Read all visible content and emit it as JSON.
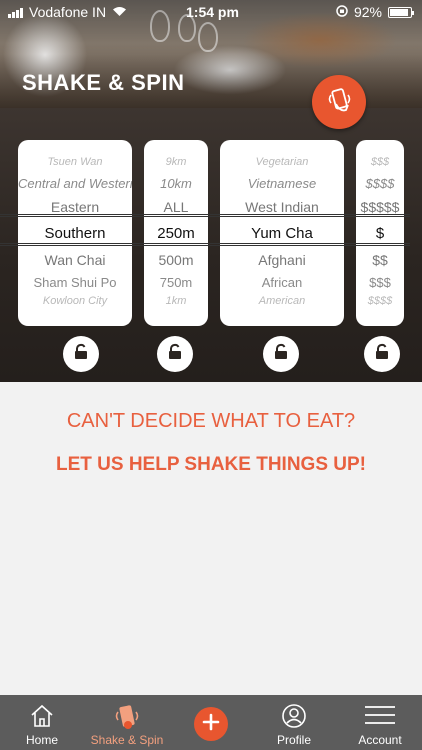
{
  "status_bar": {
    "carrier": "Vodafone IN",
    "time": "1:54 pm",
    "battery": "92%",
    "battery_level": 0.92
  },
  "header": {
    "title": "SHAKE & SPIN",
    "shake_icon": "phone-shake-icon"
  },
  "pickers": [
    {
      "name": "location",
      "items": [
        "Tsuen Wan",
        "Central and Western",
        "Eastern",
        "Southern",
        "Wan Chai",
        "Sham Shui Po",
        "Kowloon City"
      ],
      "selected": "Southern"
    },
    {
      "name": "distance",
      "items": [
        "9km",
        "10km",
        "ALL",
        "250m",
        "500m",
        "750m",
        "1km"
      ],
      "selected": "250m"
    },
    {
      "name": "cuisine",
      "items": [
        "Vegetarian",
        "Vietnamese",
        "West Indian",
        "Yum Cha",
        "Afghani",
        "African",
        "American"
      ],
      "selected": "Yum Cha"
    },
    {
      "name": "price",
      "items": [
        "$$$",
        "$$$$",
        "$$$$$",
        "$",
        "$$",
        "$$$",
        "$$$$"
      ],
      "selected": "$"
    }
  ],
  "locks": [
    "unlock-icon",
    "unlock-icon",
    "unlock-icon",
    "unlock-icon"
  ],
  "messages": {
    "line1": "CAN'T DECIDE WHAT TO EAT?",
    "line2": "LET US HELP SHAKE THINGS UP!"
  },
  "tabbar": {
    "home": "Home",
    "shake": "Shake & Spin",
    "profile": "Profile",
    "account": "Account",
    "active": "Shake & Spin"
  },
  "colors": {
    "accent": "#e8562f",
    "message": "#e8603f",
    "tabbar": "#5c5c5c",
    "panel": "#2b2521"
  }
}
